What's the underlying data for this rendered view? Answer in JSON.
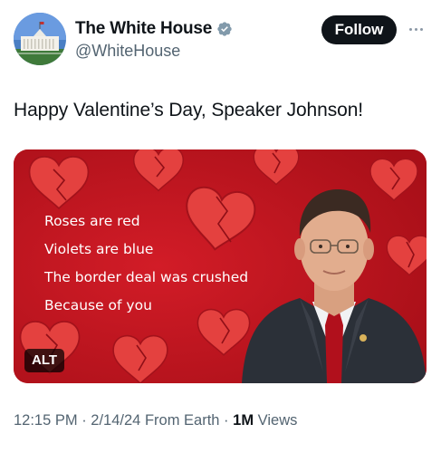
{
  "header": {
    "display_name": "The White House",
    "handle": "@WhiteHouse",
    "follow_label": "Follow",
    "verified_icon": "verified-badge-gray",
    "more_icon": "more-dots"
  },
  "tweet": {
    "text": "Happy Valentine’s Day, Speaker Johnson!"
  },
  "media": {
    "poem": [
      "Roses are red",
      "Violets are blue",
      "The border deal was crushed",
      "Because of you"
    ],
    "alt_label": "ALT",
    "background_color": "#c0141f",
    "heart_color": "#e8403f"
  },
  "meta": {
    "time": "12:15 PM",
    "sep1": " · ",
    "date": "2/14/24",
    "source": " From Earth",
    "sep2": " · ",
    "views_count": "1M",
    "views_label": " Views"
  }
}
